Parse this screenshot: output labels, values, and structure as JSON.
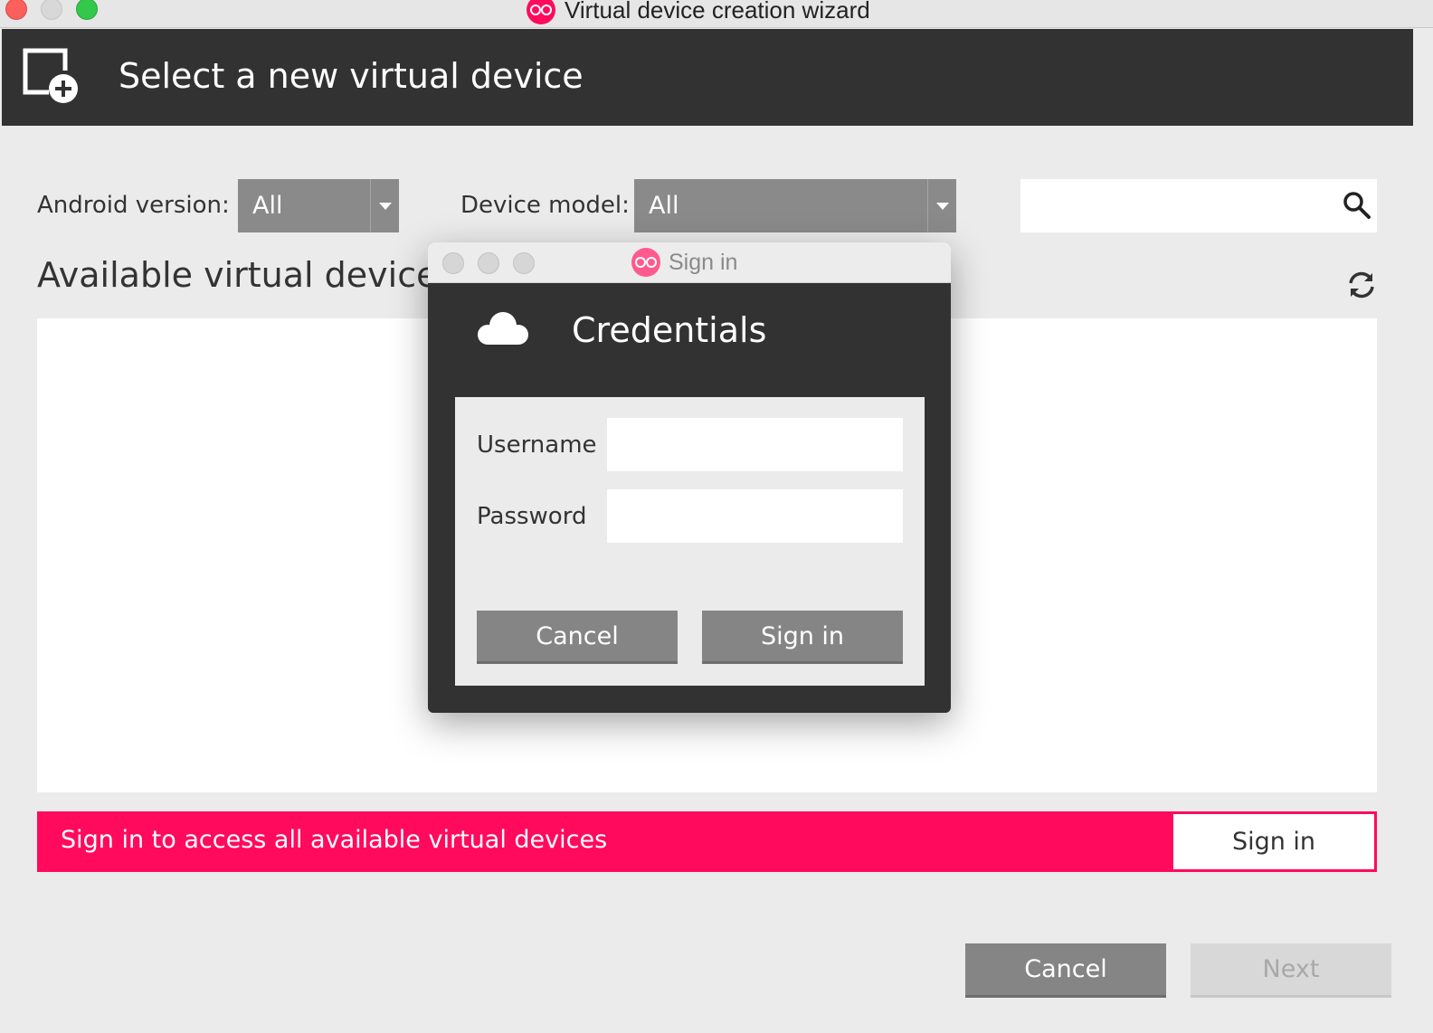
{
  "window": {
    "title": "Virtual device creation wizard",
    "logo_icon": "genymotion-logo-icon"
  },
  "header": {
    "title": "Select a new virtual device",
    "icon": "add-device-icon"
  },
  "filters": {
    "android_version_label": "Android version:",
    "android_version_value": "All",
    "device_model_label": "Device model:",
    "device_model_value": "All",
    "search_value": ""
  },
  "devices": {
    "section_title": "Available virtual devices",
    "items": []
  },
  "banner": {
    "text": "Sign in to access all available virtual devices",
    "button_label": "Sign in",
    "color": "#ff0a5c"
  },
  "footer": {
    "cancel_label": "Cancel",
    "next_label": "Next"
  },
  "signin_dialog": {
    "window_title": "Sign in",
    "heading": "Credentials",
    "username_label": "Username",
    "username_value": "",
    "password_label": "Password",
    "password_value": "",
    "cancel_label": "Cancel",
    "signin_label": "Sign in"
  }
}
